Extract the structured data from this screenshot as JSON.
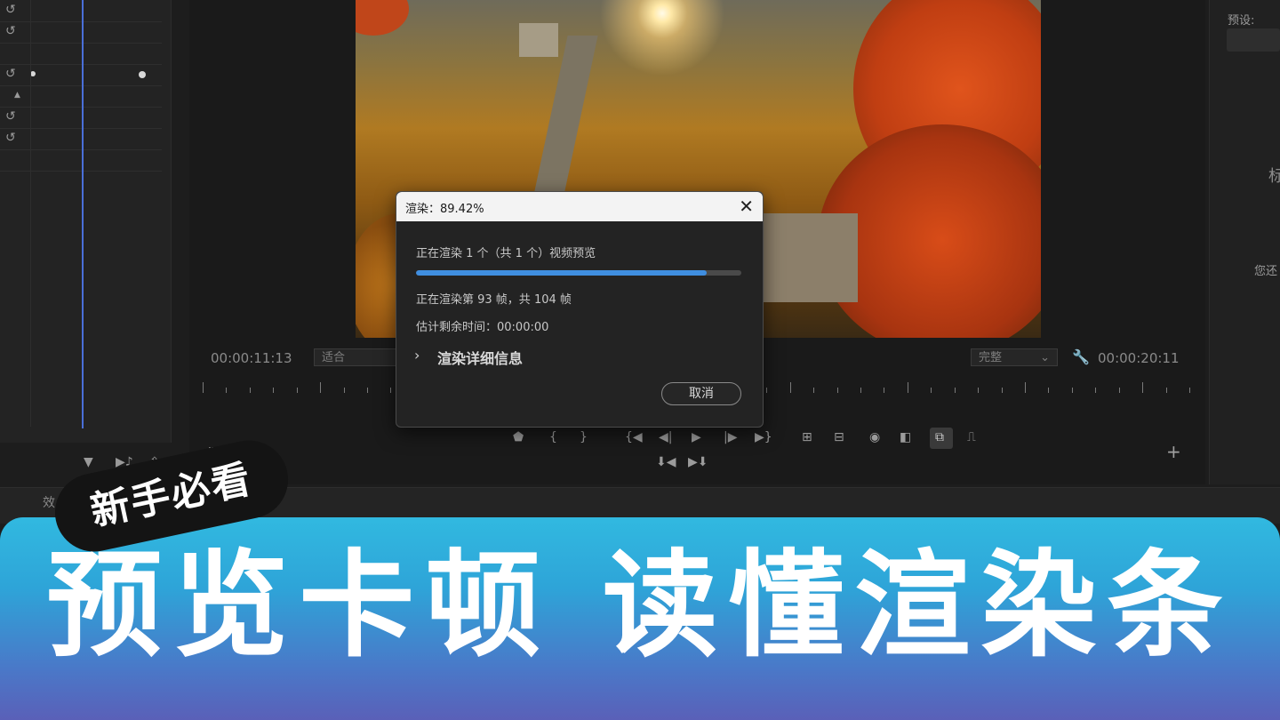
{
  "left_panel": {
    "reset_icons": [
      "reset-icon",
      "reset-icon",
      "reset-icon",
      "reset-icon",
      "reset-icon"
    ],
    "tool_icons": [
      "filter-icon",
      "play-only-audio-icon",
      "export-icon"
    ]
  },
  "monitor": {
    "current_time": "00:00:11:13",
    "fit_select": "适合",
    "quality_select": "完整",
    "total_time": "00:00:20:11"
  },
  "right_panel": {
    "preset_label": "预设:",
    "partial_char": "标",
    "partial_text": "您还"
  },
  "bottom_strip": {
    "tab_partial": "效"
  },
  "render_dialog": {
    "title": "渲染：89.42%",
    "line1": "正在渲染 1 个（共 1 个）视频预览",
    "progress": 0.8942,
    "line2": "正在渲染第 93 帧，共 104 帧",
    "line3": "估计剩余时间：00:00:00",
    "details_label": "渲染详细信息",
    "cancel_label": "取消",
    "close_glyph": "✕",
    "chevron_glyph": "›"
  },
  "overlay": {
    "badge_text": "新手必看",
    "title": "预览卡顿 读懂渲染条"
  },
  "colors": {
    "progress": "#3f8ee0",
    "banner_top": "#31b9e0",
    "banner_bottom": "#5a60b8",
    "playhead": "#4a6fd8"
  }
}
